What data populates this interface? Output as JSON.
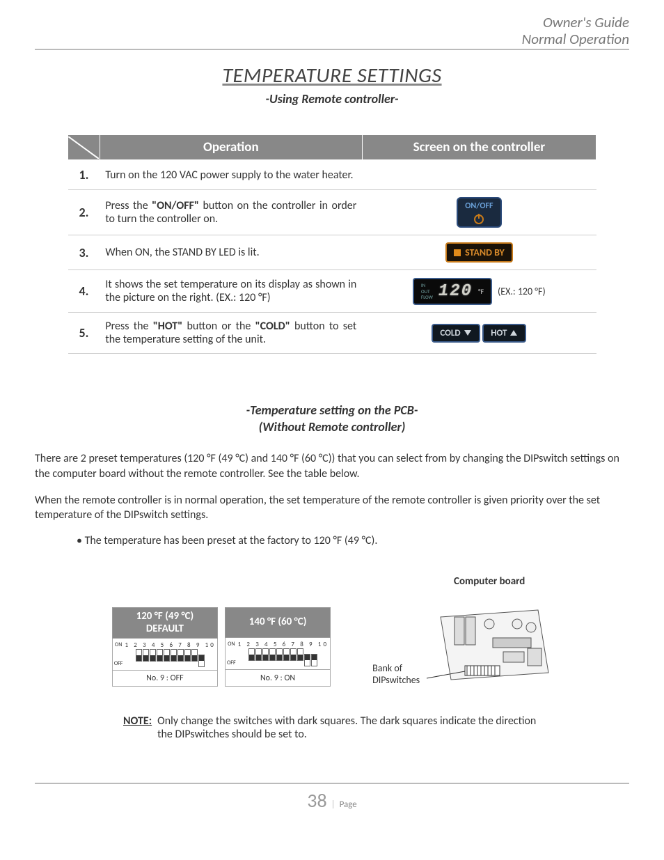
{
  "header": {
    "line1": "Owner's Guide",
    "line2": "Normal Operation"
  },
  "title": "TEMPERATURE SETTINGS",
  "subtitle": "-Using Remote controller-",
  "table": {
    "col_operation": "Operation",
    "col_screen": "Screen on the controller",
    "rows": [
      {
        "num": "1.",
        "op": "Turn on the 120 VAC power supply to the water heater."
      },
      {
        "num": "2.",
        "op_pre": "Press the ",
        "op_bold1": "\"ON/OFF\"",
        "op_post": " button on the controller in order to turn the controller on.",
        "btn_label": "ON/OFF"
      },
      {
        "num": "3.",
        "op": "When ON, the STAND BY LED is lit.",
        "standby_label": "STAND BY"
      },
      {
        "num": "4.",
        "op": "It shows the set temperature on its display as shown in the picture on the right. (EX.: 120 °F)",
        "display_labels": {
          "l1": "IN",
          "l2": "OUT",
          "l3": "FLOW"
        },
        "display_value": "120",
        "display_unit": "°F",
        "ex_text": "(EX.: 120 °F)"
      },
      {
        "num": "5.",
        "op_pre": "Press the ",
        "op_bold1": "\"HOT\"",
        "op_mid": " button or the ",
        "op_bold2": "\"COLD\"",
        "op_post": " button to set the temperature setting of the unit.",
        "cold_label": "COLD",
        "hot_label": "HOT"
      }
    ]
  },
  "pcb": {
    "title": "-Temperature setting on the PCB-",
    "subtitle": "(Without Remote controller)",
    "para1": "There are 2 preset temperatures (120 °F (49 °C) and 140 °F (60 °C)) that you can select from by changing the DIPswitch settings on the computer board without the remote controller.  See the table below.",
    "para2": "When the remote controller is in normal operation, the set temperature of the remote controller is given priority over the set temperature of the DIPswitch settings.",
    "bullet": "The temperature has been preset at the factory to 120 °F (49 °C)."
  },
  "dip": {
    "col1_line1": "120 °F (49 °C)",
    "col1_line2": "DEFAULT",
    "col2": "140 °F (60 °C)",
    "on": "ON",
    "off": "OFF",
    "nums": "1 2 3 4 5 6 7 8 9 10",
    "row1_caption": "No. 9 : OFF",
    "row2_caption": "No. 9 : ON",
    "switches_default": [
      "off",
      "off",
      "off",
      "off",
      "off",
      "off",
      "off",
      "off",
      "off",
      "on"
    ],
    "switches_140": [
      "off",
      "off",
      "off",
      "off",
      "off",
      "off",
      "off",
      "off",
      "on",
      "on"
    ]
  },
  "board": {
    "caption": "Computer board",
    "bank_label_l1": "Bank of",
    "bank_label_l2": "DIPswitches"
  },
  "note": {
    "label": "NOTE:",
    "text": "Only change the switches with dark squares.  The dark squares indicate the direction the DIPswitches should be set to."
  },
  "footer": {
    "page_num": "38",
    "page_word": "Page"
  }
}
